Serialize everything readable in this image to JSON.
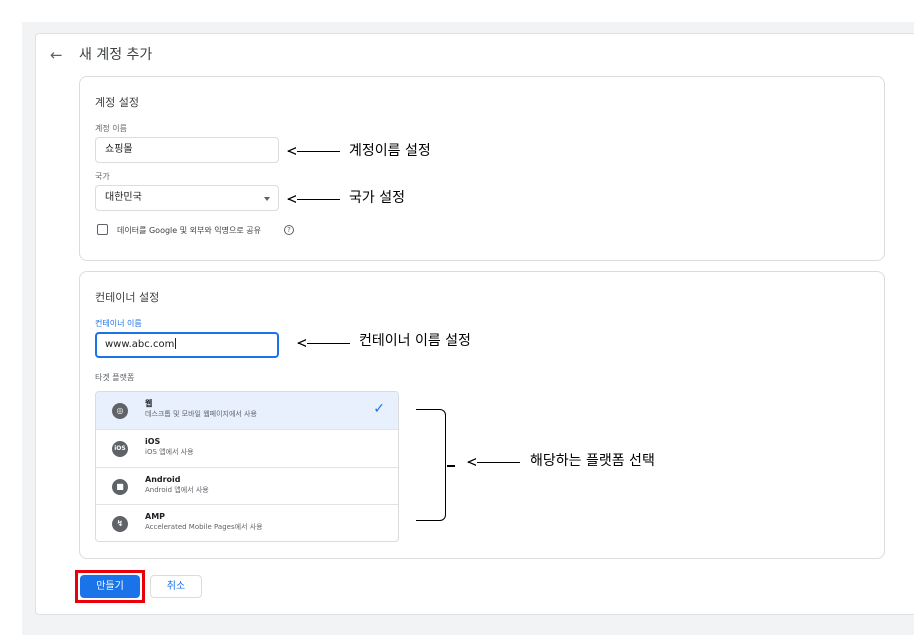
{
  "header": {
    "back_icon": "arrow-left-icon",
    "title": "새 계정 추가"
  },
  "account": {
    "section_title": "계정 설정",
    "name_label": "계정 이름",
    "name_value": "쇼핑몰",
    "country_label": "국가",
    "country_value": "대한민국",
    "share_label": "데이터를 Google 및 외부와 익명으로 공유",
    "share_checked": false
  },
  "container": {
    "section_title": "컨테이너 설정",
    "name_label": "컨테이너 이름",
    "name_value": "www.abc.com",
    "platform_label": "타겟 플랫폼",
    "platforms": [
      {
        "name": "웹",
        "desc": "데스크톱 및 모바일 웹페이지에서 사용",
        "icon": "globe-icon",
        "selected": true
      },
      {
        "name": "iOS",
        "desc": "iOS 앱에서 사용",
        "icon": "ios-icon",
        "selected": false
      },
      {
        "name": "Android",
        "desc": "Android 앱에서 사용",
        "icon": "android-icon",
        "selected": false
      },
      {
        "name": "AMP",
        "desc": "Accelerated Mobile Pages에서 사용",
        "icon": "amp-bolt-icon",
        "selected": false
      }
    ]
  },
  "buttons": {
    "create": "만들기",
    "cancel": "취소"
  },
  "annotations": {
    "account_name": "계정이름 설정",
    "country": "국가 설정",
    "container_name": "컨테이너 이름 설정",
    "platform": "해당하는 플랫폼 선택"
  },
  "colors": {
    "accent": "#1a73e8",
    "highlight_box": "#e8000b",
    "selected_row": "#e8f0fe"
  }
}
